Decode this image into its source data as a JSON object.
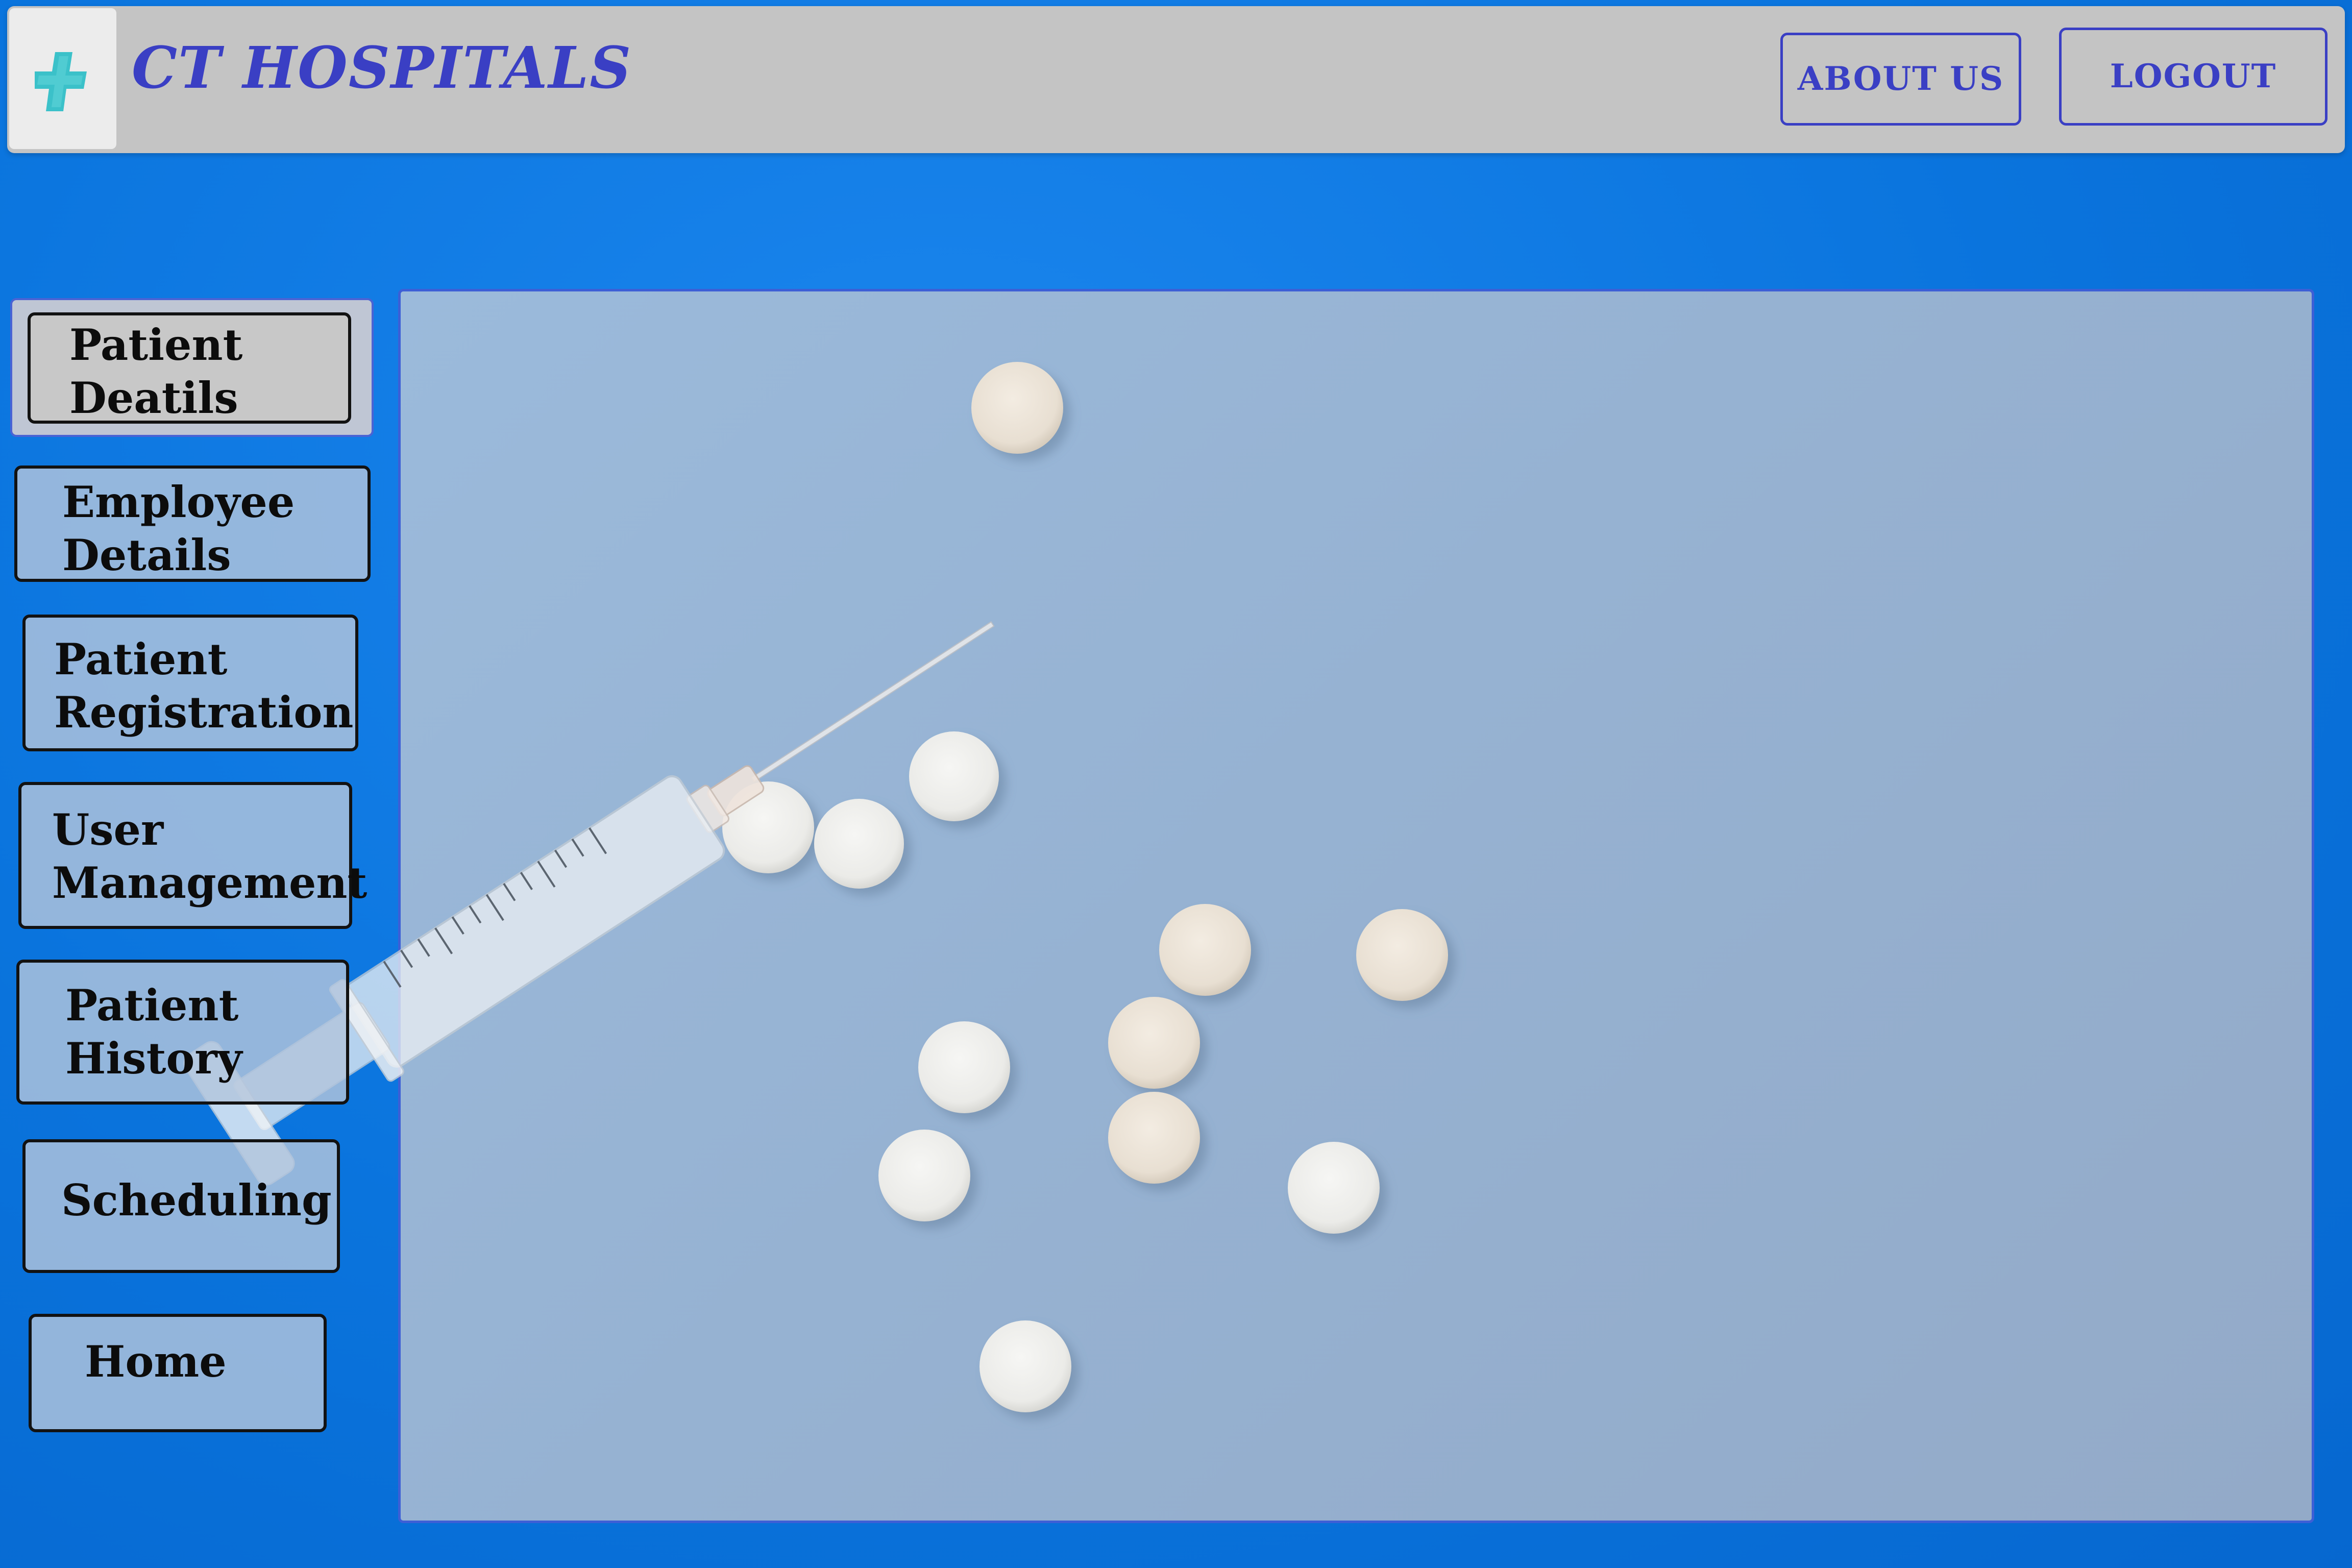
{
  "header": {
    "brand_title": "CT HOSPITALS",
    "about_label": "ABOUT US",
    "logout_label": "LOGOUT"
  },
  "sidebar": {
    "items": [
      {
        "label": "Patient\nDeatils",
        "active": true
      },
      {
        "label": "Employee\nDetails"
      },
      {
        "label": "Patient\nRegistration"
      },
      {
        "label": "User\nManagement"
      },
      {
        "label": "Patient\nHistory"
      },
      {
        "label": "Scheduling"
      },
      {
        "label": "Home"
      }
    ]
  },
  "main": {
    "image": "syringe-and-pills"
  },
  "colors": {
    "background": "#0a74dd",
    "header_bg": "#c4c4c4",
    "brand": "#3a3fc4",
    "logo_cross": "#3bc1c9",
    "panel": "#96b2d2"
  }
}
